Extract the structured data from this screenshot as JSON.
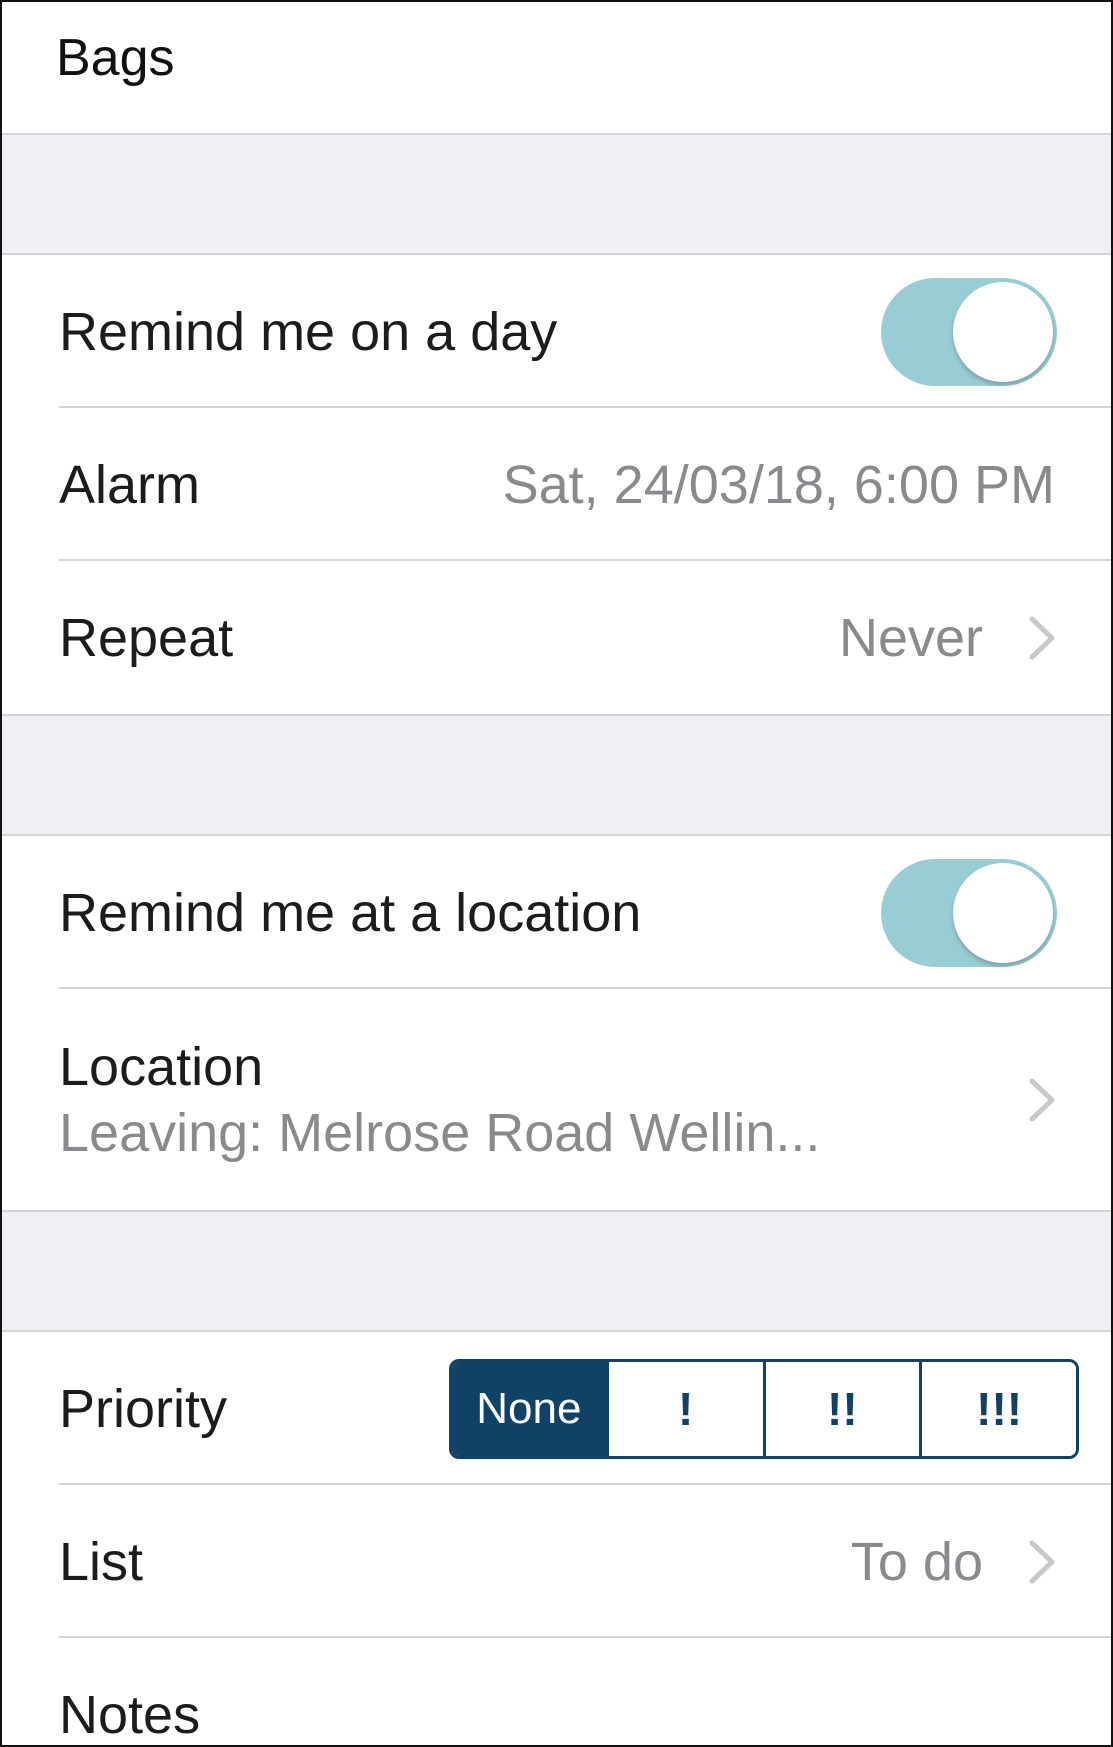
{
  "title": "Bags",
  "day_section": {
    "toggle_label": "Remind me on a day",
    "toggle_on": true,
    "alarm_label": "Alarm",
    "alarm_value": "Sat, 24/03/18, 6:00 PM",
    "repeat_label": "Repeat",
    "repeat_value": "Never"
  },
  "location_section": {
    "toggle_label": "Remind me at a location",
    "toggle_on": true,
    "location_label": "Location",
    "location_value": "Leaving: Melrose Road Wellin..."
  },
  "details_section": {
    "priority_label": "Priority",
    "priority_options": [
      "None",
      "!",
      "!!",
      "!!!"
    ],
    "priority_selected": "None",
    "list_label": "List",
    "list_value": "To do",
    "notes_label": "Notes"
  },
  "colors": {
    "toggle_track": "#99cdd5",
    "segment_accent": "#0f4266",
    "group_background": "#efeff4",
    "secondary_text": "#8a8a8e"
  },
  "icons": {
    "disclosure": "chevron-right-icon"
  }
}
